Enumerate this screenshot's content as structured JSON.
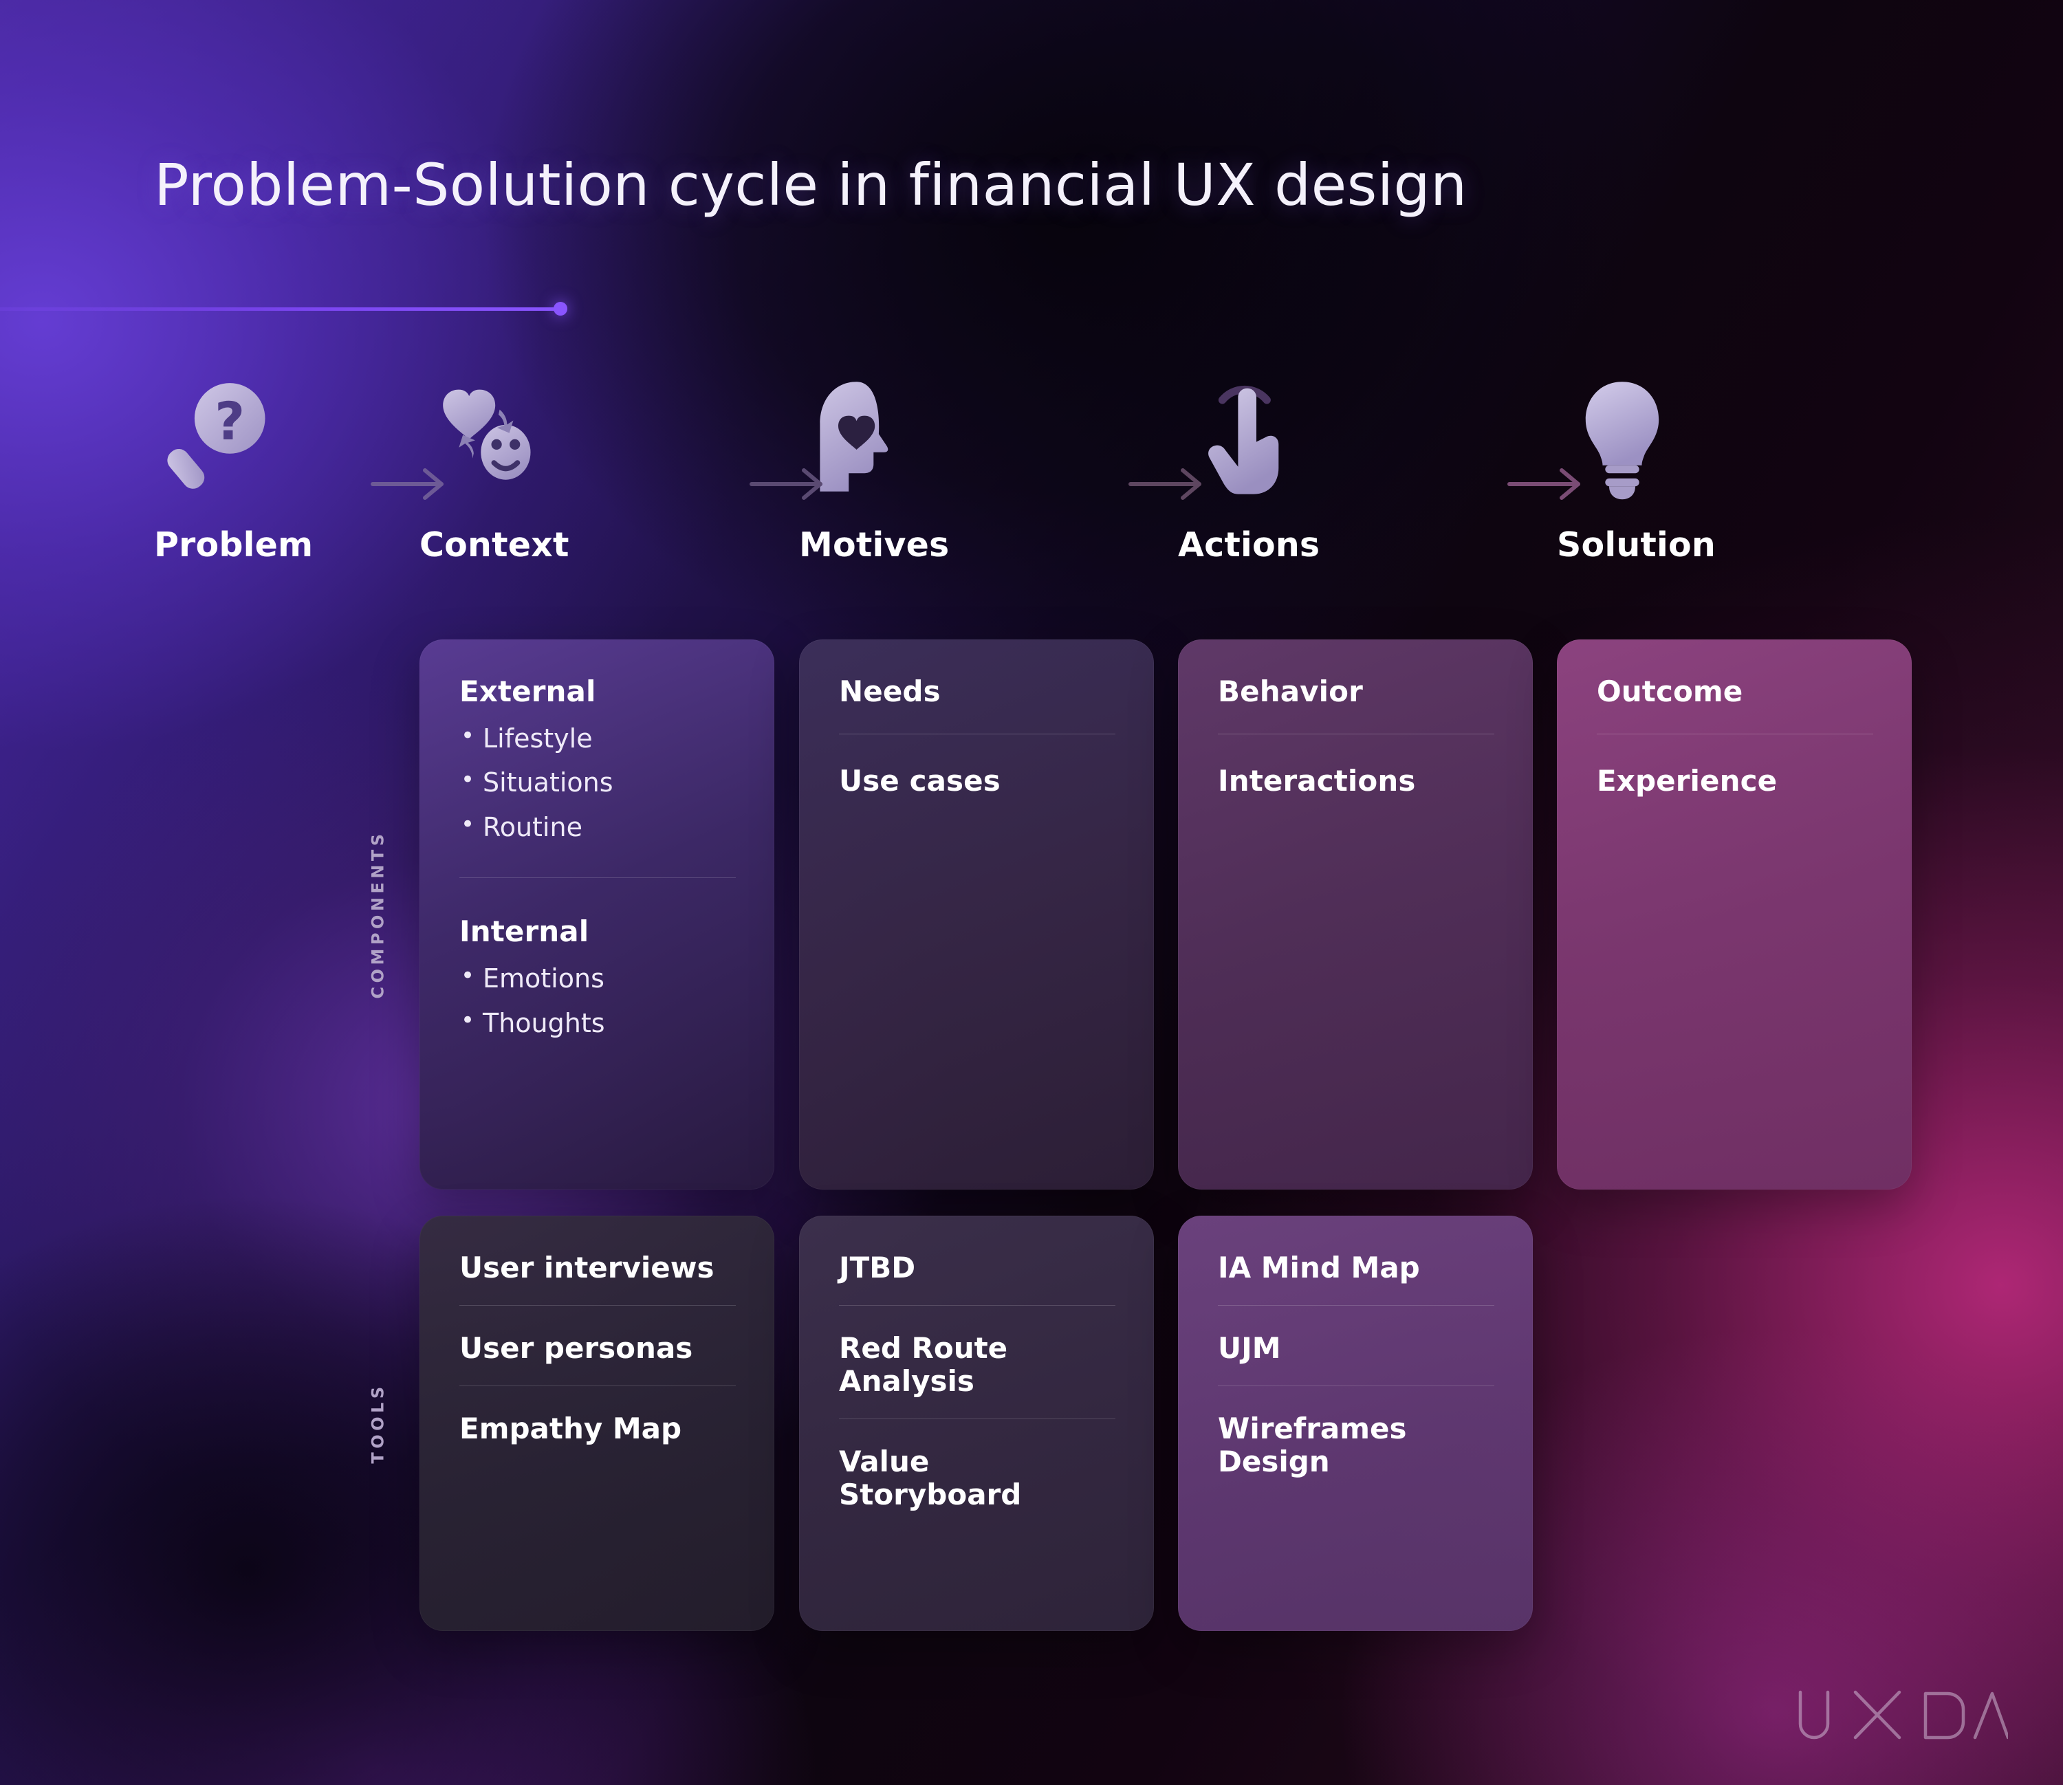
{
  "page": {
    "title": "Problem-Solution cycle in financial UX design",
    "brand": "UXDA",
    "accent_color": "#8a55ff",
    "text_color": "#ffffff"
  },
  "rails": {
    "components_label": "COMPONENTS",
    "tools_label": "TOOLS"
  },
  "steps": [
    {
      "label": "Problem",
      "icon": "magnifier-question-icon"
    },
    {
      "label": "Context",
      "icon": "heart-smiley-cycle-icon"
    },
    {
      "label": "Motives",
      "icon": "head-heart-icon"
    },
    {
      "label": "Actions",
      "icon": "tap-hand-icon"
    },
    {
      "label": "Solution",
      "icon": "lightbulb-icon"
    }
  ],
  "arrows": [
    "arrow-right-icon",
    "arrow-right-icon",
    "arrow-right-icon",
    "arrow-right-icon"
  ],
  "components": [
    {
      "step": "Context",
      "groups": [
        {
          "heading": "External",
          "items": [
            "Lifestyle",
            "Situations",
            "Routine"
          ]
        },
        {
          "heading": "Internal",
          "items": [
            "Emotions",
            "Thoughts"
          ]
        }
      ]
    },
    {
      "step": "Motives",
      "groups": [
        {
          "heading": "Needs",
          "items": []
        },
        {
          "heading": "Use cases",
          "items": []
        }
      ]
    },
    {
      "step": "Actions",
      "groups": [
        {
          "heading": "Behavior",
          "items": []
        },
        {
          "heading": "Interactions",
          "items": []
        }
      ]
    },
    {
      "step": "Solution",
      "groups": [
        {
          "heading": "Outcome",
          "items": []
        },
        {
          "heading": "Experience",
          "items": []
        }
      ]
    }
  ],
  "tools": [
    {
      "step": "Context",
      "items": [
        "User interviews",
        "User personas",
        "Empathy Map"
      ]
    },
    {
      "step": "Motives",
      "items": [
        "JTBD",
        "Red Route Analysis",
        "Value Storyboard"
      ]
    },
    {
      "step": "Actions",
      "items": [
        "IA Mind Map",
        "UJM",
        "Wireframes Design"
      ]
    }
  ]
}
